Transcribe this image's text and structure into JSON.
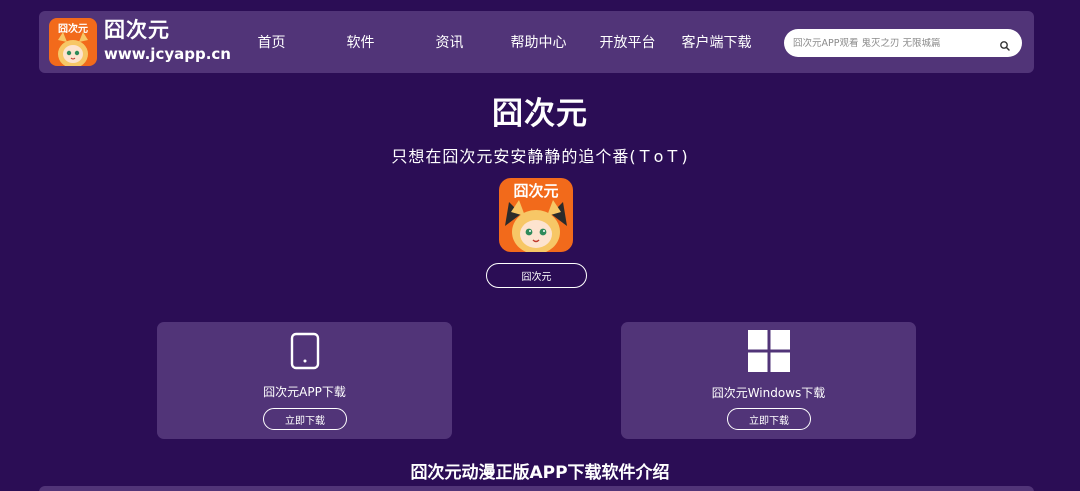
{
  "header": {
    "logo_name": "囧次元",
    "logo_domain": "www.jcyapp.cn",
    "nav": [
      {
        "label": "首页"
      },
      {
        "label": "软件"
      },
      {
        "label": "资讯"
      },
      {
        "label": "帮助中心"
      },
      {
        "label": "开放平台"
      },
      {
        "label": "客户端下载"
      }
    ],
    "search_placeholder": "囧次元APP观看 鬼灭之刃 无限城篇"
  },
  "hero": {
    "title": "囧次元",
    "subtitle": "只想在囧次元安安静静的追个番(ＴoＴ)",
    "app_name_button": "囧次元",
    "icon_text": "囧次元"
  },
  "cards": {
    "app": {
      "label": "囧次元APP下载",
      "button": "立即下载",
      "icon": "phone-icon"
    },
    "windows": {
      "label": "囧次元Windows下载",
      "button": "立即下载",
      "icon": "windows-icon"
    }
  },
  "section_title": "囧次元动漫正版APP下载软件介绍",
  "colors": {
    "background": "#2b0d55",
    "panel": "#513478",
    "icon_orange": "#f26a1b"
  }
}
